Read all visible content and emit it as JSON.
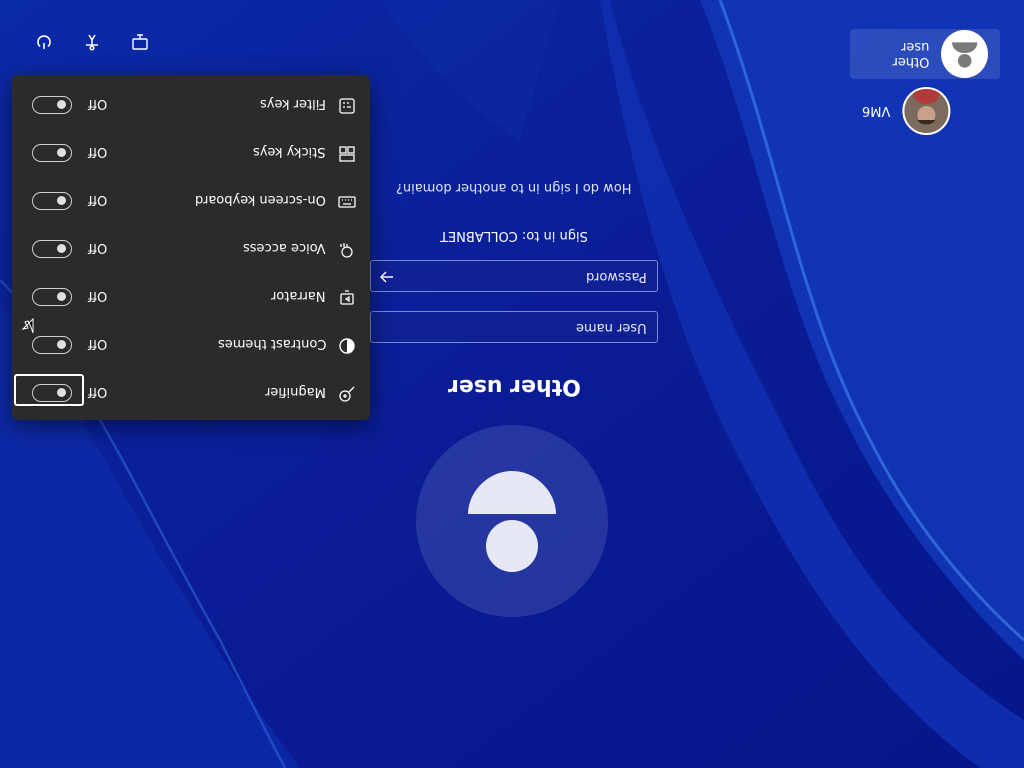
{
  "toolbar": {
    "icons": [
      "power-icon",
      "accessibility-icon",
      "network-icon"
    ]
  },
  "users": [
    {
      "name": "Other user",
      "avatar": "person-icon",
      "selected": true
    },
    {
      "name": "VM6",
      "avatar": "user-photo"
    }
  ],
  "signin": {
    "title": "Other user",
    "username_placeholder": "User name",
    "password_placeholder": "Password",
    "sign_in_to": "Sign in to: COLLABNET",
    "help_link": "How do I sign in to another domain?",
    "submit_icon": "arrow-right-icon"
  },
  "accessibility": {
    "items": [
      {
        "label": "Filter keys",
        "icon": "filter-keys-icon",
        "state": "Off",
        "on": false
      },
      {
        "label": "Sticky keys",
        "icon": "sticky-keys-icon",
        "state": "Off",
        "on": false
      },
      {
        "label": "On-screen keyboard",
        "icon": "keyboard-icon",
        "state": "Off",
        "on": false
      },
      {
        "label": "Voice access",
        "icon": "voice-access-icon",
        "state": "Off",
        "on": false
      },
      {
        "label": "Narrator",
        "icon": "narrator-icon",
        "state": "Off",
        "on": false
      },
      {
        "label": "Contrast themes",
        "icon": "contrast-icon",
        "state": "Off",
        "on": false
      },
      {
        "label": "Magnifier",
        "icon": "magnifier-icon",
        "state": "Off",
        "on": false
      }
    ]
  },
  "colors": {
    "background": "#0a1f9e",
    "flyout": "#2b2b2b",
    "field_border": "#b4c3ff"
  }
}
